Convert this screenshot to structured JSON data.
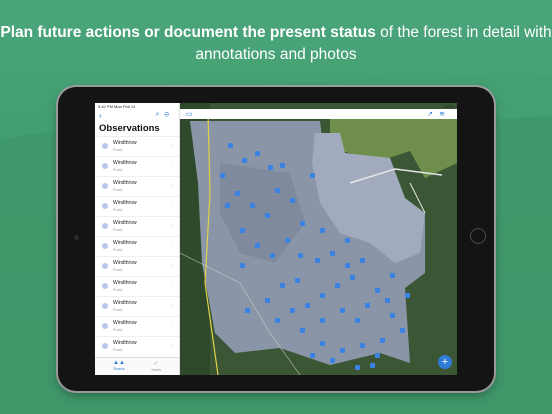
{
  "headline": {
    "bold": "Plan future actions or document the present status",
    "rest": " of the forest in detail with annotations and photos"
  },
  "statusbar": {
    "time": "3:42 PM   Mon Feb 14",
    "battery": "100%"
  },
  "sidebar": {
    "title": "Observations",
    "items": [
      {
        "name": "Windthrow",
        "type": "Point"
      },
      {
        "name": "Windthrow",
        "type": "Point"
      },
      {
        "name": "Windthrow",
        "type": "Point"
      },
      {
        "name": "Windthrow",
        "type": "Point"
      },
      {
        "name": "Windthrow",
        "type": "Point"
      },
      {
        "name": "Windthrow",
        "type": "Point"
      },
      {
        "name": "Windthrow",
        "type": "Point"
      },
      {
        "name": "Windthrow",
        "type": "Point"
      },
      {
        "name": "Windthrow",
        "type": "Point"
      },
      {
        "name": "Windthrow",
        "type": "Point"
      },
      {
        "name": "Windthrow",
        "type": "Point"
      }
    ],
    "tabs": [
      {
        "label": "Scene",
        "icon": "scene-icon"
      },
      {
        "label": "Tasks",
        "icon": "check-icon"
      }
    ]
  },
  "map": {
    "add_label": "+"
  },
  "colors": {
    "background": "#4aa57a",
    "accent": "#2f7bd6",
    "marker": "#3a82e6"
  }
}
